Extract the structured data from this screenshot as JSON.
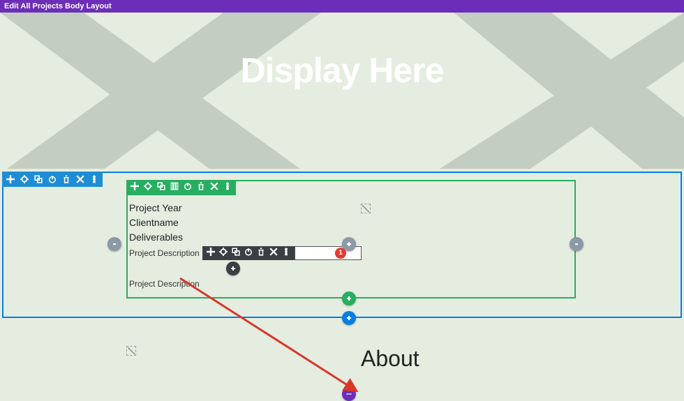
{
  "topbar": {
    "title": "Edit All Projects Body Layout"
  },
  "hero": {
    "title": "Display Here"
  },
  "row_content": {
    "line1": "Project Year",
    "line2": "Clientname",
    "line3": "Deliverables",
    "pd1": "Project Description",
    "pd2": "Project Description"
  },
  "about": {
    "heading": "About"
  },
  "badge": {
    "num": "1"
  },
  "colors": {
    "purple": "#6c2eb9",
    "blue": "#0a7de3",
    "green": "#27ae60",
    "dark": "#3a3f44"
  }
}
